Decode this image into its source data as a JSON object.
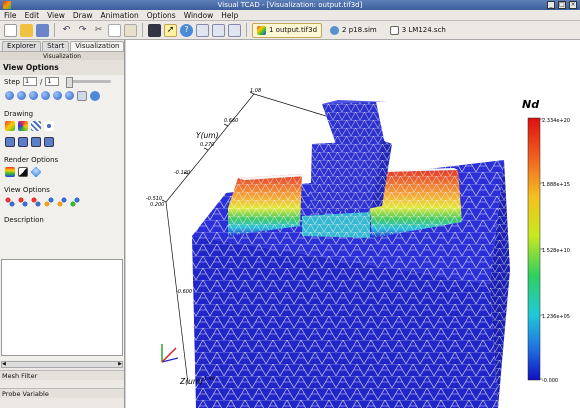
{
  "window": {
    "title": "Visual TCAD - [Visualization: output.tif3d]"
  },
  "menu": [
    "File",
    "Edit",
    "View",
    "Draw",
    "Animation",
    "Options",
    "Window",
    "Help"
  ],
  "doc_tabs": [
    {
      "label": "1 output.tif3d",
      "icon": "mesh-icon"
    },
    {
      "label": "2 p18.sim",
      "icon": "sim-icon"
    },
    {
      "label": "3 LM124.sch",
      "icon": "schematic-icon"
    }
  ],
  "panel": {
    "tabs": [
      "Explorer",
      "Start",
      "Visualization"
    ],
    "header": "Visualization",
    "view_options_title": "View Options",
    "step_label": "Step",
    "step_value": "1",
    "step_sep": "/",
    "step_total": "1",
    "drawing_label": "Drawing",
    "render_label": "Render Options",
    "view_label": "View Options",
    "description_label": "Description",
    "mesh_filter": "Mesh Filter",
    "probe_variable": "Probe Variable"
  },
  "plot": {
    "legend_title": "Nd",
    "legend_ticks": [
      "2.334e+20",
      "1.888e+15",
      "1.528e+10",
      "1.236e+05",
      "-0.000"
    ],
    "y_axis_label": "Y(um)",
    "y_ticks": [
      "1.08",
      "0.660",
      "0.270",
      "-0.120",
      "-0.510"
    ],
    "y_tick_extra": "0.200",
    "z_axis_label": "Z(um)",
    "z_ticks": [
      "-0.600",
      "-1.40"
    ]
  }
}
